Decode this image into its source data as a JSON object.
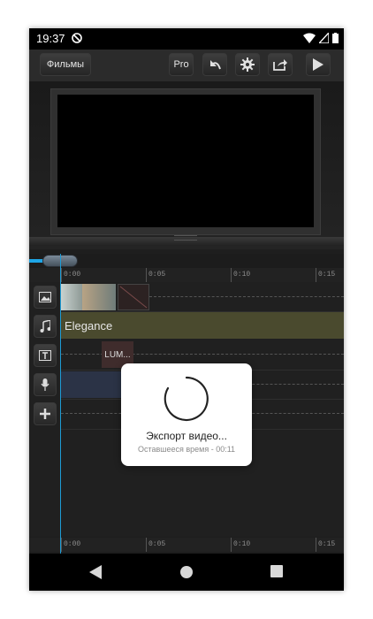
{
  "status_bar": {
    "time": "19:37"
  },
  "toolbar": {
    "films_label": "Фильмы",
    "pro_label": "Pro"
  },
  "timeline": {
    "ruler_labels": [
      "0:00",
      "0:05",
      "0:10",
      "0:15"
    ],
    "music_clip_label": "Elegance",
    "title_clip_label": "LUM..."
  },
  "export_dialog": {
    "title": "Экспорт видео...",
    "remaining": "Оставшееся время - 00:11"
  },
  "icons": [
    "photo-icon",
    "music-note-icon",
    "text-icon",
    "microphone-icon",
    "plus-icon",
    "undo-icon",
    "gear-icon",
    "share-icon",
    "play-icon"
  ],
  "colors": {
    "accent": "#1ea5e6",
    "music_track": "#4a4a2e",
    "voice_track": "#2b3346"
  }
}
